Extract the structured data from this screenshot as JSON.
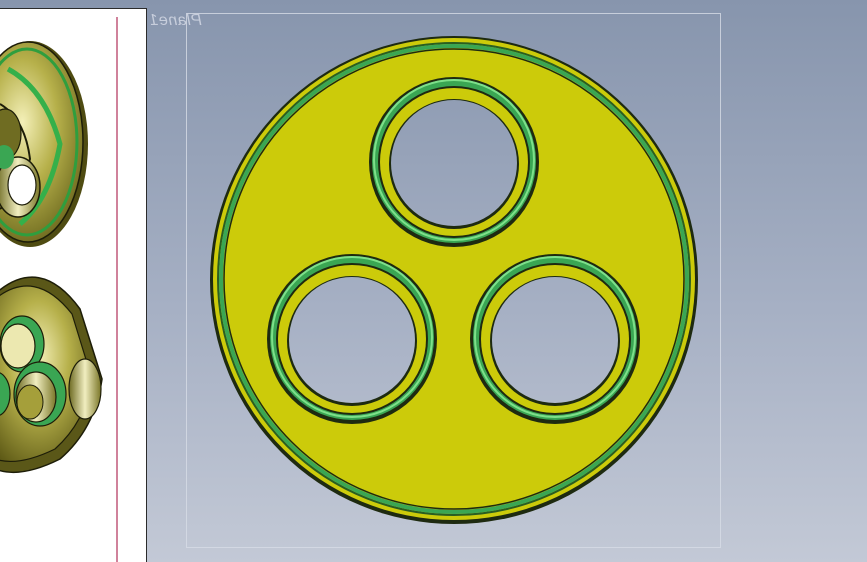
{
  "viewport": {
    "plane_label": "Plane1",
    "background_top": "#8795ad",
    "background_bottom": "#c3c9d6"
  },
  "model": {
    "face_color": "#cccb0a",
    "edge_color": "#1e2a10",
    "groove_color": "#3aa653",
    "groove_highlight": "#7ee08a",
    "holes": [
      "hole-top",
      "hole-bottom-left",
      "hole-bottom-right"
    ]
  },
  "preview_panel": {
    "views": [
      "preview-isometric-top",
      "preview-isometric-bottom"
    ],
    "accent_line": "#c0587a"
  }
}
